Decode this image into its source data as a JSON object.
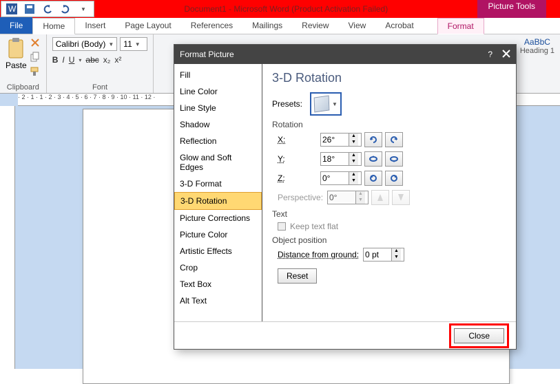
{
  "title": "Document1 - Microsoft Word (Product Activation Failed)",
  "context_tab_group": "Picture Tools",
  "tabs": {
    "file": "File",
    "home": "Home",
    "insert": "Insert",
    "page_layout": "Page Layout",
    "references": "References",
    "mailings": "Mailings",
    "review": "Review",
    "view": "View",
    "acrobat": "Acrobat",
    "format": "Format"
  },
  "ribbon": {
    "clipboard": {
      "label": "Clipboard",
      "paste": "Paste"
    },
    "font": {
      "label": "Font",
      "name": "Calibri (Body)",
      "size": "11",
      "bold": "B",
      "italic": "I",
      "underline": "U",
      "strike": "abc",
      "sub": "x₂",
      "sup": "x²"
    },
    "styles": {
      "sample": "AaBbC",
      "heading1": "Heading 1"
    }
  },
  "ruler_marks": "· 2 · 1 · 1 · 2 · 3 · 4 · 5 · 6 · 7 · 8 · 9 · 10 · 11 · 12 ·",
  "doc_btn": "L",
  "dialog": {
    "title": "Format Picture",
    "help": "?",
    "nav": [
      "Fill",
      "Line Color",
      "Line Style",
      "Shadow",
      "Reflection",
      "Glow and Soft Edges",
      "3-D Format",
      "3-D Rotation",
      "Picture Corrections",
      "Picture Color",
      "Artistic Effects",
      "Crop",
      "Text Box",
      "Alt Text"
    ],
    "nav_sel": 7,
    "heading": "3-D Rotation",
    "presets_label": "Presets:",
    "rotation_label": "Rotation",
    "x_label": "X:",
    "x_val": "26°",
    "y_label": "Y:",
    "y_val": "18°",
    "z_label": "Z:",
    "z_val": "0°",
    "persp_label": "Perspective:",
    "persp_val": "0°",
    "text_section": "Text",
    "keep_flat": "Keep text flat",
    "objpos_section": "Object position",
    "dist_label": "Distance from ground:",
    "dist_val": "0 pt",
    "reset": "Reset",
    "close": "Close"
  }
}
